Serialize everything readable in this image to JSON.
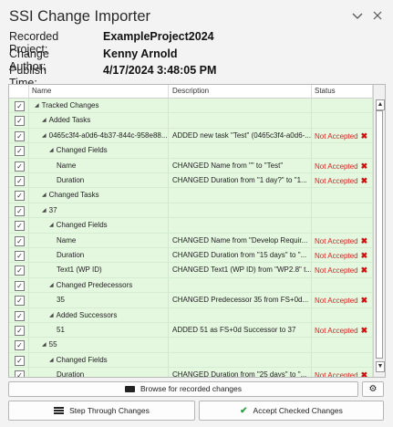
{
  "window": {
    "title": "SSI Change Importer",
    "collapse_icon": "chevron-down",
    "close_icon": "close-x"
  },
  "meta": {
    "project_label": "Recorded Project:",
    "project_value": "ExampleProject2024",
    "author_label": "Change Author:",
    "author_value": "Kenny Arnold",
    "time_label": "Publish Time:",
    "time_value": "4/17/2024 3:48:05 PM"
  },
  "grid": {
    "columns": [
      "Name",
      "Description",
      "Status"
    ],
    "rows": [
      {
        "indent": 0,
        "expander": true,
        "name": "Tracked Changes",
        "desc": "",
        "status": "",
        "checked": true
      },
      {
        "indent": 1,
        "expander": true,
        "name": "Added Tasks",
        "desc": "",
        "status": "",
        "checked": true
      },
      {
        "indent": 1,
        "expander": true,
        "name": "0465c3f4-a0d6-4b37-844c-958e88...",
        "desc": "ADDED new task \"Test\" (0465c3f4-a0d6-...",
        "status": "Not Accepted",
        "checked": true
      },
      {
        "indent": 2,
        "expander": true,
        "name": "Changed Fields",
        "desc": "",
        "status": "",
        "checked": true
      },
      {
        "indent": 3,
        "expander": false,
        "name": "Name",
        "desc": "CHANGED Name from \"\" to \"Test\"",
        "status": "Not Accepted",
        "checked": true
      },
      {
        "indent": 3,
        "expander": false,
        "name": "Duration",
        "desc": "CHANGED Duration from \"1 day?\" to \"1...",
        "status": "Not Accepted",
        "checked": true
      },
      {
        "indent": 1,
        "expander": true,
        "name": "Changed Tasks",
        "desc": "",
        "status": "",
        "checked": true
      },
      {
        "indent": 1,
        "expander": true,
        "name": "37",
        "desc": "",
        "status": "",
        "checked": true
      },
      {
        "indent": 2,
        "expander": true,
        "name": "Changed Fields",
        "desc": "",
        "status": "",
        "checked": true
      },
      {
        "indent": 3,
        "expander": false,
        "name": "Name",
        "desc": "CHANGED Name from \"Develop Requir...",
        "status": "Not Accepted",
        "checked": true
      },
      {
        "indent": 3,
        "expander": false,
        "name": "Duration",
        "desc": "CHANGED Duration from \"15 days\" to \"...",
        "status": "Not Accepted",
        "checked": true
      },
      {
        "indent": 3,
        "expander": false,
        "name": "Text1 (WP ID)",
        "desc": "CHANGED Text1 (WP ID) from \"WP2.8\" t...",
        "status": "Not Accepted",
        "checked": true
      },
      {
        "indent": 2,
        "expander": true,
        "name": "Changed Predecessors",
        "desc": "",
        "status": "",
        "checked": true
      },
      {
        "indent": 3,
        "expander": false,
        "name": "35",
        "desc": "CHANGED Predecessor 35 from FS+0d...",
        "status": "Not Accepted",
        "checked": true
      },
      {
        "indent": 2,
        "expander": true,
        "name": "Added Successors",
        "desc": "",
        "status": "",
        "checked": true
      },
      {
        "indent": 3,
        "expander": false,
        "name": "51",
        "desc": "ADDED 51 as FS+0d Successor to 37",
        "status": "Not Accepted",
        "checked": true
      },
      {
        "indent": 1,
        "expander": true,
        "name": "55",
        "desc": "",
        "status": "",
        "checked": true
      },
      {
        "indent": 2,
        "expander": true,
        "name": "Changed Fields",
        "desc": "",
        "status": "",
        "checked": true
      },
      {
        "indent": 3,
        "expander": false,
        "name": "Duration",
        "desc": "CHANGED Duration from \"25 days\" to \"...",
        "status": "Not Accepted",
        "checked": true
      }
    ]
  },
  "buttons": {
    "browse": "Browse for recorded changes",
    "step": "Step Through Changes",
    "accept": "Accept Checked Changes"
  },
  "icons": {
    "browse": "folder-icon",
    "settings": "gear-icon",
    "step": "list-icon",
    "accept": "check-icon"
  },
  "colors": {
    "row_green": "#e4f7df",
    "status_red": "#e02020",
    "check_green": "#2ea043"
  }
}
